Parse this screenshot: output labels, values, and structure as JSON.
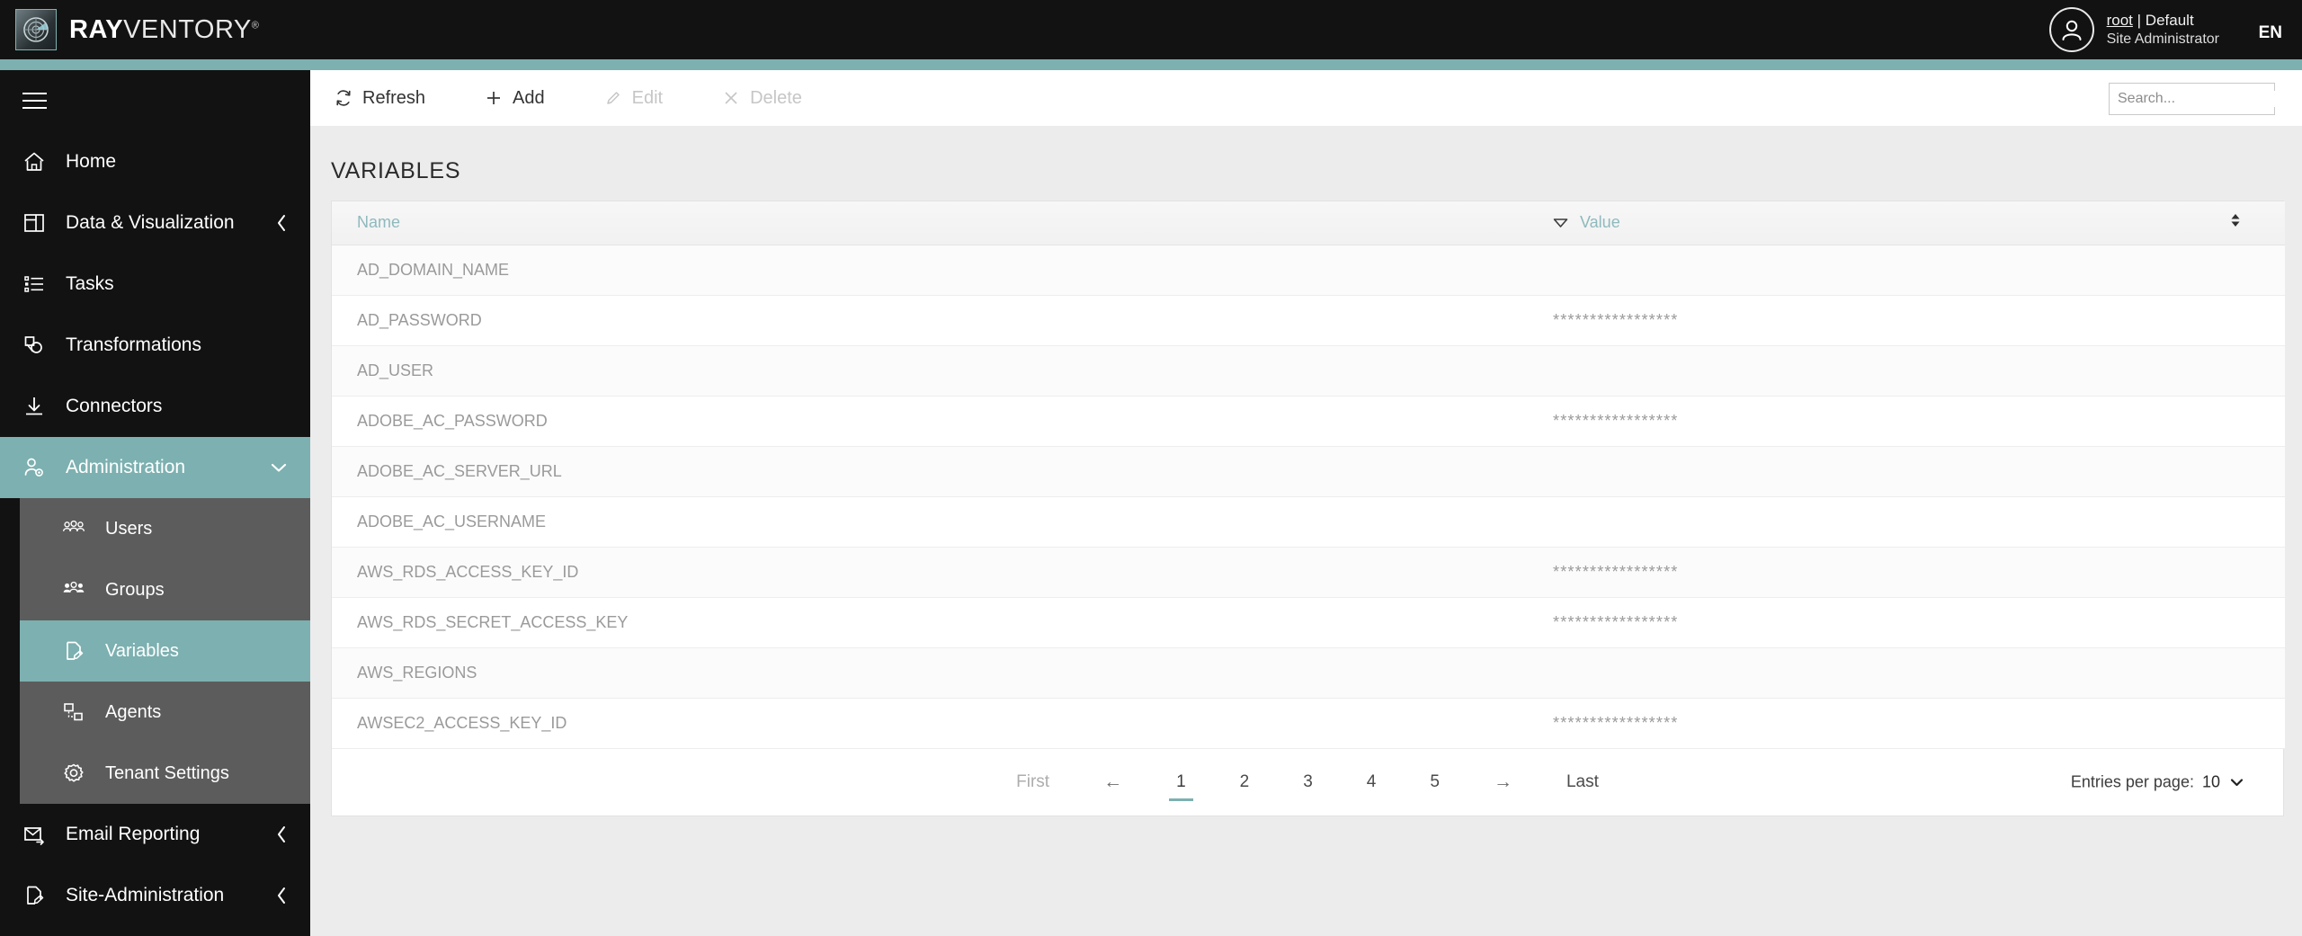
{
  "header": {
    "logo": {
      "bold": "RAY",
      "light": "VENTORY",
      "registered": "®",
      "icon": "radar-icon"
    },
    "user": {
      "name": "root",
      "separator": "|",
      "tenant": "Default",
      "role": "Site Administrator"
    },
    "language": "EN"
  },
  "sidebar": {
    "menu_icon": "hamburger-icon",
    "items": [
      {
        "label": "Home",
        "icon": "home-icon",
        "state": "normal",
        "chevron": null
      },
      {
        "label": "Data & Visualization",
        "icon": "dashboard-icon",
        "state": "normal",
        "chevron": "chevron-left-icon"
      },
      {
        "label": "Tasks",
        "icon": "list-icon",
        "state": "normal",
        "chevron": null
      },
      {
        "label": "Transformations",
        "icon": "transform-icon",
        "state": "normal",
        "chevron": null
      },
      {
        "label": "Connectors",
        "icon": "download-icon",
        "state": "normal",
        "chevron": null
      },
      {
        "label": "Administration",
        "icon": "user-gear-icon",
        "state": "expanded",
        "chevron": "chevron-down-icon"
      },
      {
        "label": "Users",
        "icon": "users-icon",
        "state": "sub",
        "chevron": null
      },
      {
        "label": "Groups",
        "icon": "groups-icon",
        "state": "sub",
        "chevron": null
      },
      {
        "label": "Variables",
        "icon": "variable-doc-icon",
        "state": "sub-active",
        "chevron": null
      },
      {
        "label": "Agents",
        "icon": "agents-icon",
        "state": "sub",
        "chevron": null
      },
      {
        "label": "Tenant Settings",
        "icon": "gear-icon",
        "state": "sub",
        "chevron": null
      },
      {
        "label": "Email Reporting",
        "icon": "mail-forward-icon",
        "state": "normal",
        "chevron": "chevron-left-icon"
      },
      {
        "label": "Site-Administration",
        "icon": "variable-doc-icon",
        "state": "normal",
        "chevron": "chevron-left-icon"
      }
    ]
  },
  "toolbar": {
    "refresh_label": "Refresh",
    "add_label": "Add",
    "edit_label": "Edit",
    "delete_label": "Delete"
  },
  "search": {
    "placeholder": "Search...",
    "value": "",
    "icon": "search-icon"
  },
  "main": {
    "title": "VARIABLES"
  },
  "table": {
    "columns": [
      {
        "key": "name",
        "label": "Name"
      },
      {
        "key": "value",
        "label": "Value"
      }
    ],
    "sort_caret_icon": "sort-descending-caret-icon",
    "column_tools_icon": "sort-updown-icon",
    "rows": [
      {
        "name": "AD_DOMAIN_NAME",
        "value": ""
      },
      {
        "name": "AD_PASSWORD",
        "value": "*****************"
      },
      {
        "name": "AD_USER",
        "value": ""
      },
      {
        "name": "ADOBE_AC_PASSWORD",
        "value": "*****************"
      },
      {
        "name": "ADOBE_AC_SERVER_URL",
        "value": ""
      },
      {
        "name": "ADOBE_AC_USERNAME",
        "value": ""
      },
      {
        "name": "AWS_RDS_ACCESS_KEY_ID",
        "value": "*****************"
      },
      {
        "name": "AWS_RDS_SECRET_ACCESS_KEY",
        "value": "*****************"
      },
      {
        "name": "AWS_REGIONS",
        "value": ""
      },
      {
        "name": "AWSEC2_ACCESS_KEY_ID",
        "value": "*****************"
      }
    ]
  },
  "pagination": {
    "first_label": "First",
    "prev_icon": "arrow-left-icon",
    "prev_label": "←",
    "pages": [
      "1",
      "2",
      "3",
      "4",
      "5"
    ],
    "current_page": "1",
    "next_icon": "arrow-right-icon",
    "next_label": "→",
    "last_label": "Last",
    "entries_label": "Entries per page:",
    "entries_value": "10",
    "entries_caret_icon": "chevron-down-icon"
  },
  "colors": {
    "accent_teal": "#7db0b0",
    "header_black": "#121212",
    "submenu_gray": "#5c5c5c",
    "content_gray": "#ececec",
    "header_text_teal": "#8fb9bd"
  }
}
